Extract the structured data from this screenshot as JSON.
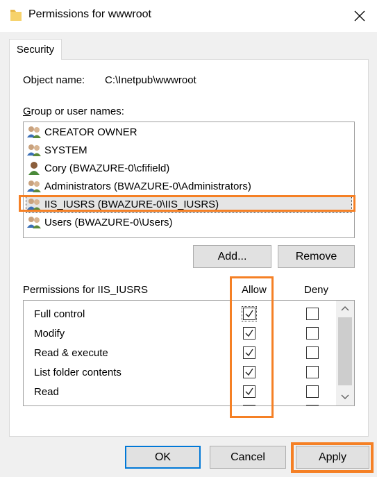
{
  "window": {
    "title": "Permissions for wwwroot",
    "folder_icon": "folder-icon",
    "close_icon": "close-icon"
  },
  "tabs": [
    {
      "label": "Security",
      "selected": true
    }
  ],
  "object": {
    "label": "Object name:",
    "value": "C:\\Inetpub\\wwwroot"
  },
  "group_label": "Group or user names:",
  "users": [
    {
      "name": "CREATOR OWNER",
      "icon": "group-icon",
      "selected": false
    },
    {
      "name": "SYSTEM",
      "icon": "group-icon",
      "selected": false
    },
    {
      "name": "Cory (BWAZURE-0\\cfifield)",
      "icon": "user-icon",
      "selected": false
    },
    {
      "name": "Administrators (BWAZURE-0\\Administrators)",
      "icon": "group-icon",
      "selected": false
    },
    {
      "name": "IIS_IUSRS (BWAZURE-0\\IIS_IUSRS)",
      "icon": "group-icon",
      "selected": true
    },
    {
      "name": "Users (BWAZURE-0\\Users)",
      "icon": "group-icon",
      "selected": false
    }
  ],
  "buttons": {
    "add": "Add...",
    "remove": "Remove",
    "ok": "OK",
    "cancel": "Cancel",
    "apply": "Apply"
  },
  "permissions": {
    "title": "Permissions for IIS_IUSRS",
    "allow_header": "Allow",
    "deny_header": "Deny",
    "rows": [
      {
        "label": "Full control",
        "allow": true,
        "deny": false
      },
      {
        "label": "Modify",
        "allow": true,
        "deny": false
      },
      {
        "label": "Read & execute",
        "allow": true,
        "deny": false
      },
      {
        "label": "List folder contents",
        "allow": true,
        "deny": false
      },
      {
        "label": "Read",
        "allow": true,
        "deny": false
      }
    ]
  },
  "colors": {
    "highlight": "#f58025",
    "focus_border": "#0078d7"
  }
}
